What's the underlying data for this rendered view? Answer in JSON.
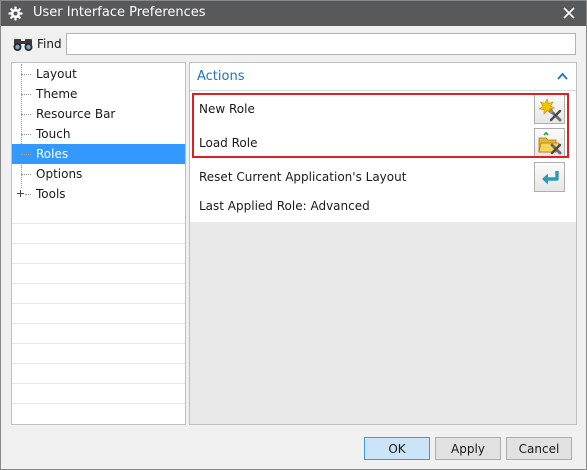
{
  "window": {
    "title": "User Interface Preferences"
  },
  "find": {
    "label": "Find",
    "value": ""
  },
  "tree": {
    "items": [
      {
        "label": "Layout"
      },
      {
        "label": "Theme"
      },
      {
        "label": "Resource Bar"
      },
      {
        "label": "Touch"
      },
      {
        "label": "Roles",
        "selected": true
      },
      {
        "label": "Options"
      },
      {
        "label": "Tools",
        "expandable": true
      }
    ]
  },
  "actions": {
    "title": "Actions",
    "new_role": "New Role",
    "load_role": "Load Role",
    "reset_layout": "Reset Current Application's Layout",
    "last_applied": "Last Applied Role: Advanced"
  },
  "buttons": {
    "ok": "OK",
    "apply": "Apply",
    "cancel": "Cancel"
  },
  "colors": {
    "titlebar": "#58595b",
    "selection": "#3399ff",
    "section_title": "#1e73be",
    "highlight": "#e02020",
    "ok_button": "#cce4f7"
  }
}
